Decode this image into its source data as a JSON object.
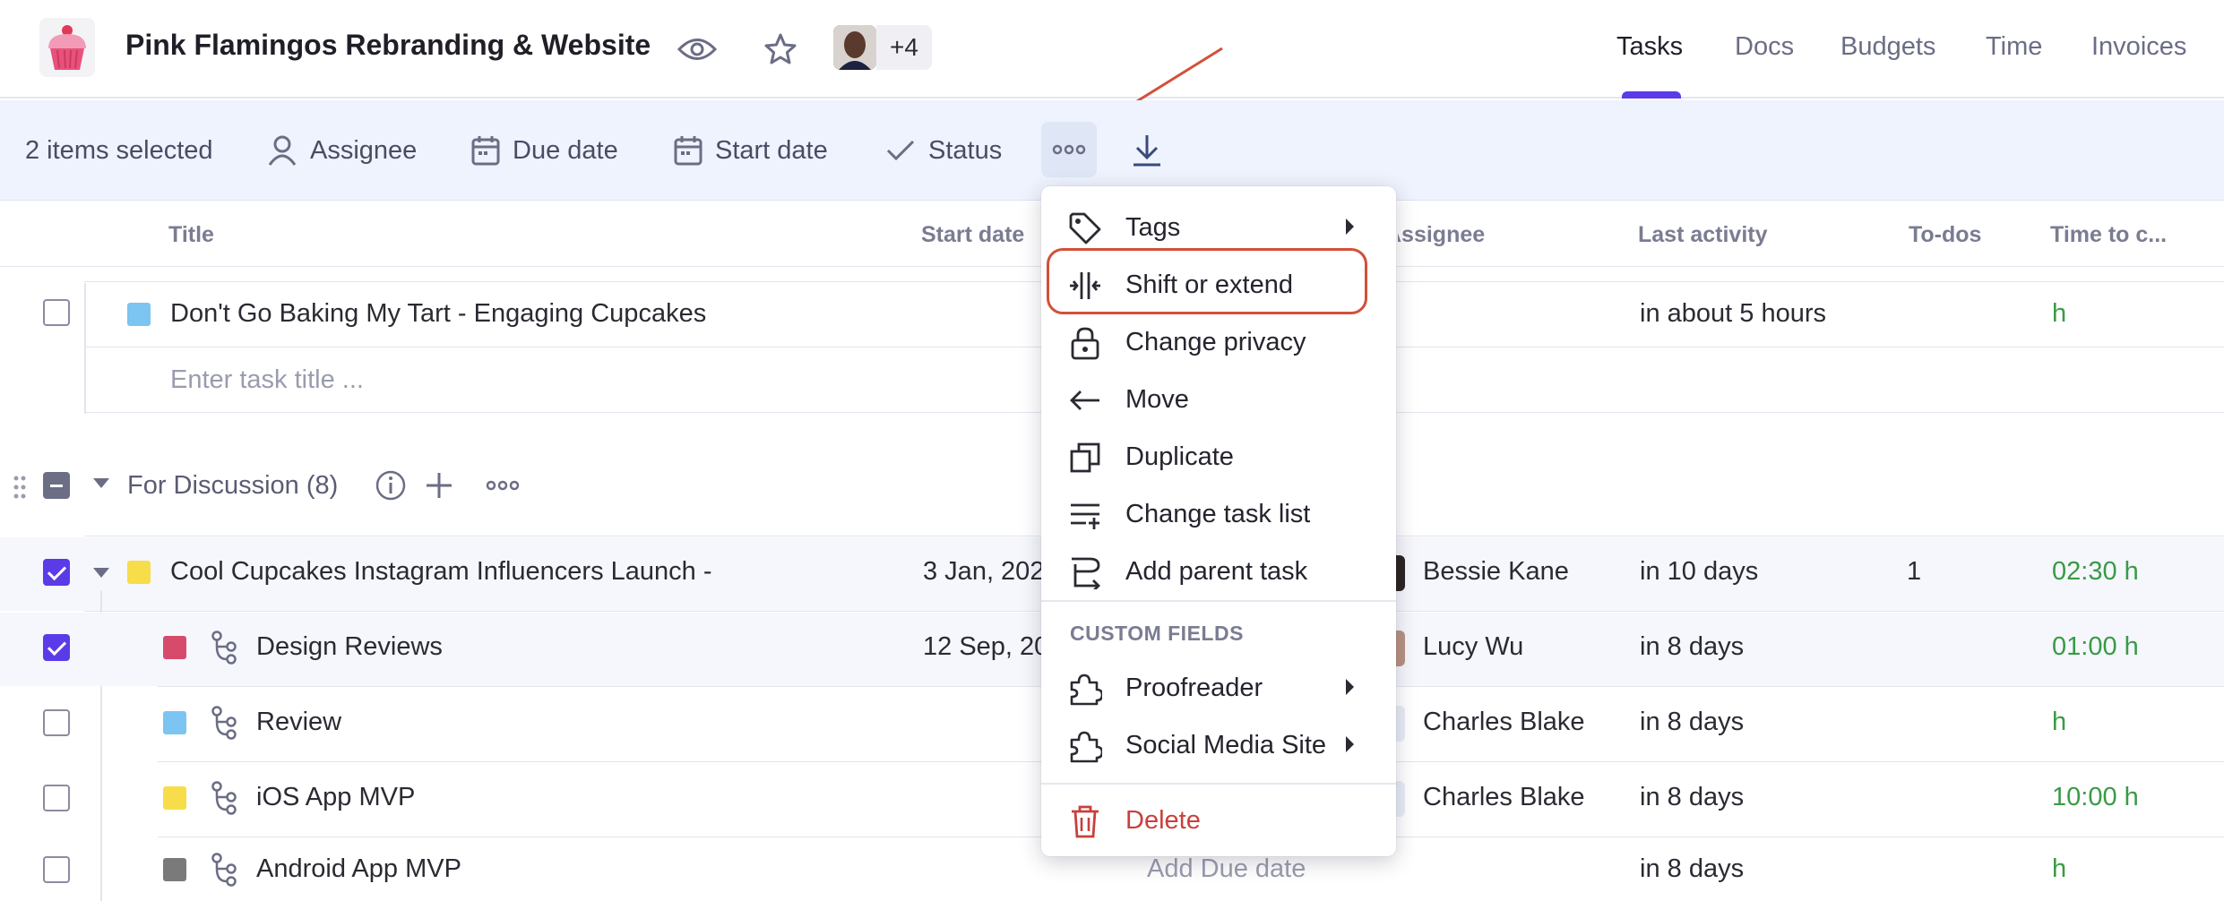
{
  "header": {
    "project_title": "Pink Flamingos Rebranding & Website",
    "members_more": "+4",
    "tabs": [
      {
        "label": "Tasks",
        "active": true
      },
      {
        "label": "Docs",
        "active": false
      },
      {
        "label": "Budgets",
        "active": false
      },
      {
        "label": "Time",
        "active": false
      },
      {
        "label": "Invoices",
        "active": false
      }
    ]
  },
  "bulkbar": {
    "selected_label": "2 items selected",
    "assignee": "Assignee",
    "due_date": "Due date",
    "start_date": "Start date",
    "status": "Status"
  },
  "columns": {
    "title": "Title",
    "start_date": "Start date",
    "assignee": "Assignee",
    "last_activity": "Last activity",
    "todos": "To-dos",
    "time": "Time to c..."
  },
  "rows_top": {
    "task": "Don't Go Baking My Tart - Engaging Cupcakes",
    "last_activity": "in about 5 hours",
    "time": "h",
    "new_task_placeholder": "Enter task title ..."
  },
  "group": {
    "name": "For Discussion (8)"
  },
  "tasks": [
    {
      "title": "Cool Cupcakes Instagram Influencers Launch -",
      "start": "3 Jan, 202",
      "assignee": "Bessie Kane",
      "activity": "in 10 days",
      "todos": "1",
      "time": "02:30 h",
      "color": "#f7dd4a",
      "checked": true,
      "subtask": false
    },
    {
      "title": "Design Reviews",
      "start": "12 Sep, 20",
      "assignee": "Lucy Wu",
      "activity": "in 8 days",
      "todos": "",
      "time": "01:00 h",
      "color": "#d64b6c",
      "checked": true,
      "subtask": true
    },
    {
      "title": "Review",
      "start": "",
      "assignee": "Charles Blake",
      "activity": "in 8 days",
      "todos": "",
      "time": "h",
      "color": "#7cc4f2",
      "checked": false,
      "subtask": true
    },
    {
      "title": "iOS App MVP",
      "start": "",
      "assignee": "Charles Blake",
      "activity": "in 8 days",
      "todos": "",
      "time": "10:00 h",
      "color": "#f7dd4a",
      "checked": false,
      "subtask": true
    },
    {
      "title": "Android App MVP",
      "start": "",
      "assignee": "",
      "due_placeholder": "Add Due date",
      "activity": "in 8 days",
      "todos": "",
      "time": "h",
      "color": "#7a7a7a",
      "checked": false,
      "subtask": true
    }
  ],
  "menu": {
    "tags": "Tags",
    "shift_extend": "Shift or extend",
    "change_privacy": "Change privacy",
    "move": "Move",
    "duplicate": "Duplicate",
    "change_task_list": "Change task list",
    "add_parent_task": "Add parent task",
    "custom_fields_heading": "CUSTOM FIELDS",
    "proofreader": "Proofreader",
    "social_media_site": "Social Media Site",
    "delete": "Delete"
  },
  "colors": {
    "accent": "#5b3be8",
    "annotation": "#d2503a",
    "danger": "#c9403c",
    "time_green": "#3a9a46",
    "bulkbar_bg": "#eef3fd"
  },
  "icons": [
    "cupcake-logo-icon",
    "eye-icon",
    "star-icon",
    "person-icon",
    "calendar-icon",
    "check-icon",
    "more-icon",
    "download-icon",
    "tag-icon",
    "shift-icon",
    "lock-icon",
    "arrow-left-icon",
    "duplicate-icon",
    "list-icon",
    "parent-task-icon",
    "puzzle-icon",
    "trash-icon",
    "info-icon",
    "plus-icon",
    "drag-handle-icon",
    "subtask-icon"
  ]
}
